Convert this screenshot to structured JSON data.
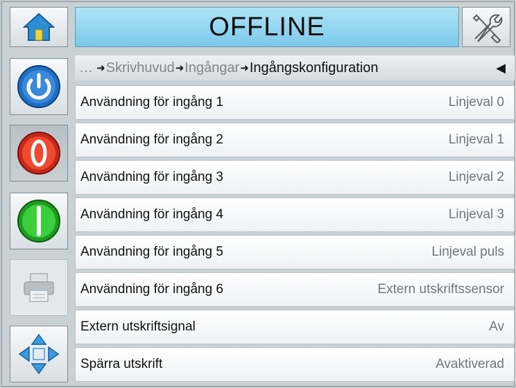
{
  "header": {
    "status": "OFFLINE",
    "home_icon": "home-icon",
    "tools_icon": "tools-icon"
  },
  "sidebar": [
    {
      "name": "power-button",
      "icon": "power-icon",
      "color": "#1e6fc4"
    },
    {
      "name": "stop-button",
      "icon": "stop-icon",
      "color": "#e0301e"
    },
    {
      "name": "start-button",
      "icon": "start-icon",
      "color": "#22b022"
    },
    {
      "name": "print-button",
      "icon": "printer-icon",
      "color": "#9aa3a8"
    },
    {
      "name": "navigate-button",
      "icon": "arrows-icon",
      "color": "#2b8fd8"
    }
  ],
  "breadcrumb": {
    "ellipsis": "…",
    "items": [
      "Skrivhuvud",
      "Ingångar",
      "Ingångskonfiguration"
    ],
    "back_icon": "back-arrow-icon"
  },
  "rows": [
    {
      "label": "Användning för ingång 1",
      "value": "Linjeval 0"
    },
    {
      "label": "Användning för ingång 2",
      "value": "Linjeval 1"
    },
    {
      "label": "Användning för ingång 3",
      "value": "Linjeval 2"
    },
    {
      "label": "Användning för ingång 4",
      "value": "Linjeval 3"
    },
    {
      "label": "Användning för ingång 5",
      "value": "Linjeval puls"
    },
    {
      "label": "Användning för ingång 6",
      "value": "Extern utskriftssensor"
    },
    {
      "label": "Extern utskriftsignal",
      "value": "Av"
    },
    {
      "label": "Spärra utskrift",
      "value": "Avaktiverad"
    }
  ]
}
